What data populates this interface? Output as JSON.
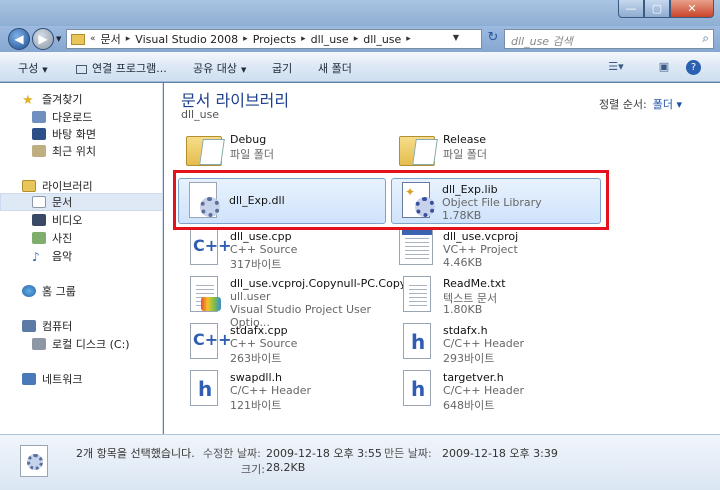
{
  "window": {
    "controls": {
      "minimize": "—",
      "maximize": "▢",
      "close": "✕"
    }
  },
  "address": {
    "prefix": "«",
    "crumbs": [
      "문서",
      "Visual Studio 2008",
      "Projects",
      "dll_use",
      "dll_use"
    ],
    "search_placeholder": "dll_use 검색"
  },
  "toolbar": {
    "organize": "구성",
    "open_with": "연결 프로그램...",
    "share": "공유 대상",
    "burn": "굽기",
    "new_folder": "새 폴더"
  },
  "nav": {
    "favorites": "즐겨찾기",
    "downloads": "다운로드",
    "desktop": "바탕 화면",
    "recent": "최근 위치",
    "libraries": "라이브러리",
    "documents": "문서",
    "videos": "비디오",
    "pictures": "사진",
    "music": "음악",
    "homegroup": "홈 그룹",
    "computer": "컴퓨터",
    "local_disk": "로컬 디스크 (C:)",
    "network": "네트워크"
  },
  "content": {
    "library_title": "문서 라이브러리",
    "library_sub": "dll_use",
    "arrange_label": "정렬 순서:",
    "arrange_value": "폴더"
  },
  "files": [
    {
      "name": "Debug",
      "type": "파일 폴더",
      "size": ""
    },
    {
      "name": "Release",
      "type": "파일 폴더",
      "size": ""
    },
    {
      "name": "dll_Exp.dll",
      "type": "",
      "size": ""
    },
    {
      "name": "dll_Exp.lib",
      "type": "Object File Library",
      "size": "1.78KB"
    },
    {
      "name": "dll_use.cpp",
      "type": "C++ Source",
      "size": "317바이트"
    },
    {
      "name": "dll_use.vcproj",
      "type": "VC++ Project",
      "size": "4.46KB"
    },
    {
      "name": "dll_use.vcproj.Copynull-PC.Copyn",
      "name2": "ull.user",
      "type": "Visual Studio Project User Optio...",
      "size": ""
    },
    {
      "name": "ReadMe.txt",
      "type": "텍스트 문서",
      "size": "1.80KB"
    },
    {
      "name": "stdafx.cpp",
      "type": "C++ Source",
      "size": "263바이트"
    },
    {
      "name": "stdafx.h",
      "type": "C/C++ Header",
      "size": "293바이트"
    },
    {
      "name": "swapdll.h",
      "type": "C/C++ Header",
      "size": "121바이트"
    },
    {
      "name": "targetver.h",
      "type": "C/C++ Header",
      "size": "648바이트"
    }
  ],
  "status": {
    "selected": "2개 항목을 선택했습니다.",
    "modified_label": "수정한 날짜:",
    "modified_value": "2009-12-18 오후 3:55",
    "created_label": "만든 날짜:",
    "created_value": "2009-12-18 오후 3:39",
    "size_label": "크기:",
    "size_value": "28.2KB"
  },
  "colors": {
    "selection_border": "#e4121d",
    "library_title": "#1e3f8c"
  }
}
